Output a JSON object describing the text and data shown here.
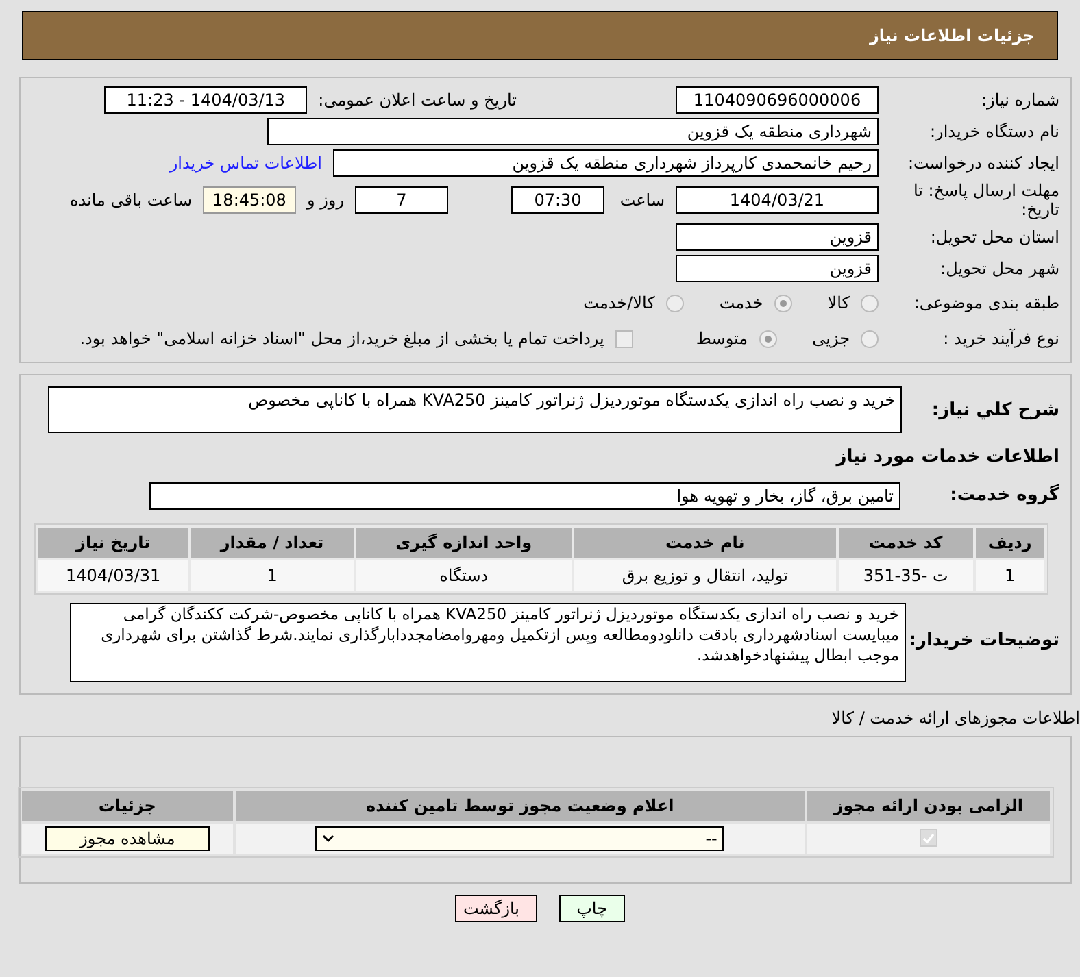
{
  "header": {
    "title": "جزئیات اطلاعات نیاز"
  },
  "need_number": {
    "label": "شماره نیاز:",
    "value": "1104090696000006"
  },
  "announce": {
    "label": "تاریخ و ساعت اعلان عمومی:",
    "value": "1404/03/13 - 11:23"
  },
  "buyer": {
    "label": "نام دستگاه خریدار:",
    "value": "شهرداری منطقه یک قزوین"
  },
  "requester": {
    "label": "ایجاد کننده درخواست:",
    "value": "رحیم خانمحمدی کارپرداز شهرداری منطقه یک قزوین",
    "link": "اطلاعات تماس خریدار"
  },
  "deadline": {
    "label": "مهلت ارسال پاسخ: تا تاریخ:",
    "date": "1404/03/21",
    "time_label": "ساعت",
    "time": "07:30",
    "days": "7",
    "days_label": "روز و",
    "remaining": "18:45:08",
    "remaining_label": "ساعت باقی مانده"
  },
  "province": {
    "label": "استان محل تحویل:",
    "value": "قزوین"
  },
  "city": {
    "label": "شهر محل تحویل:",
    "value": "قزوین"
  },
  "category": {
    "label": "طبقه بندی موضوعی:",
    "options": [
      {
        "label": "کالا",
        "selected": false
      },
      {
        "label": "خدمت",
        "selected": true
      },
      {
        "label": "کالا/خدمت",
        "selected": false
      }
    ]
  },
  "process": {
    "label": "نوع فرآیند خرید :",
    "options": [
      {
        "label": "جزیی",
        "selected": false
      },
      {
        "label": "متوسط",
        "selected": true
      }
    ],
    "payment": {
      "label": "پرداخت تمام یا بخشی از مبلغ خرید،از محل \"اسناد خزانه اسلامی\" خواهد بود.",
      "checked": false
    }
  },
  "summary": {
    "label": "شرح کلي نياز:",
    "value": "خرید و نصب راه اندازی یکدستگاه موتوردیزل ژنراتور  کامینز KVA250 همراه با کاناپی مخصوص"
  },
  "services_title": "اطلاعات خدمات مورد نياز",
  "service_group": {
    "label": "گروه خدمت:",
    "value": "تامین برق، گاز، بخار و تهویه هوا"
  },
  "services_table": {
    "columns": [
      "ردیف",
      "کد خدمت",
      "نام خدمت",
      "واحد اندازه گیری",
      "تعداد / مقدار",
      "تاریخ نیاز"
    ],
    "rows": [
      [
        "1",
        "ت -35-351",
        "تولید، انتقال و توزیع برق",
        "دستگاه",
        "1",
        "1404/03/31"
      ]
    ]
  },
  "buyer_notes": {
    "label": "توضیحات خریدار:",
    "value": "خرید و نصب راه اندازی یکدستگاه موتوردیزل ژنراتور  کامینز KVA250 همراه با کاناپی مخصوص-شرکت ککندگان گرامی میبایست اسنادشهرداری بادقت دانلودومطالعه وپس ازتکمیل ومهروامضامجددابارگذاری نمایند.شرط گذاشتن برای شهرداری موجب ابطال پیشنهادخواهدشد."
  },
  "licenses_title": "اطلاعات مجوزهای ارائه خدمت / کالا",
  "licenses_table": {
    "columns": [
      "الزامی بودن ارائه مجوز",
      "اعلام وضعیت مجوز توسط تامین کننده",
      "جزئیات"
    ],
    "rows": [
      {
        "required": true,
        "status": "--",
        "details": "مشاهده مجوز"
      }
    ]
  },
  "buttons": [
    {
      "kind": "print",
      "label": "چاپ"
    },
    {
      "kind": "back",
      "label": "بازگشت"
    }
  ]
}
